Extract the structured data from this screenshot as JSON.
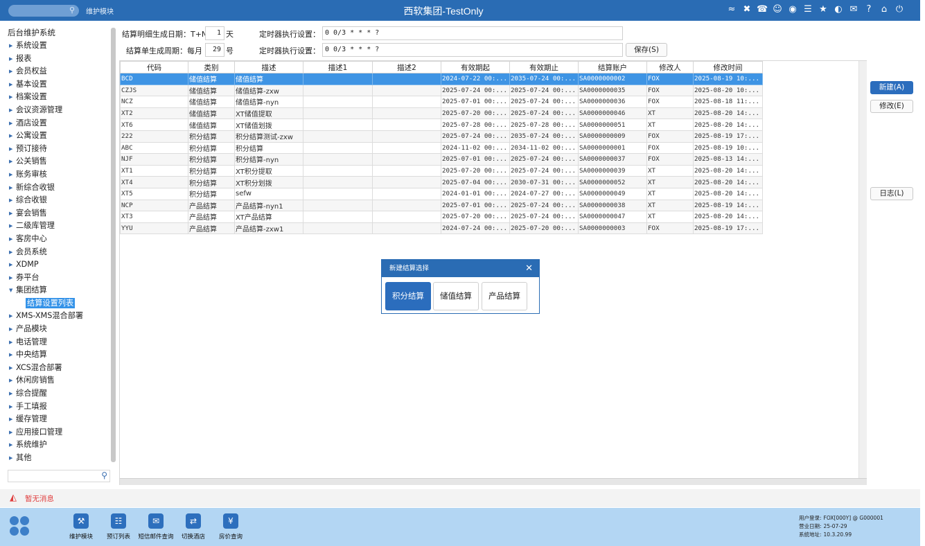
{
  "titlebar": {
    "search_placeholder": "",
    "module": "维护模块",
    "title": "西软集团-TestOnly",
    "icons": [
      "wifi-icon",
      "tools-icon",
      "phone-icon",
      "chat-icon",
      "palette-icon",
      "menu-icon",
      "star-icon",
      "contrast-icon",
      "mail-icon",
      "help-icon",
      "home-icon",
      "power-icon"
    ]
  },
  "sidebar": {
    "root": "后台维护系统",
    "items": [
      {
        "label": "系统设置"
      },
      {
        "label": "报表"
      },
      {
        "label": "会员权益"
      },
      {
        "label": "基本设置"
      },
      {
        "label": "档案设置"
      },
      {
        "label": "会议资源管理"
      },
      {
        "label": "酒店设置"
      },
      {
        "label": "公寓设置"
      },
      {
        "label": "预订接待"
      },
      {
        "label": "公关销售"
      },
      {
        "label": "账务审核"
      },
      {
        "label": "新综合收银"
      },
      {
        "label": "综合收银"
      },
      {
        "label": "宴会销售"
      },
      {
        "label": "二级库管理"
      },
      {
        "label": "客房中心"
      },
      {
        "label": "会员系统"
      },
      {
        "label": "XDMP"
      },
      {
        "label": "券平台"
      },
      {
        "label": "集团结算"
      }
    ],
    "active_sub": "结算设置列表",
    "items_after": [
      {
        "label": "XMS-XMS混合部署"
      },
      {
        "label": "产品模块"
      },
      {
        "label": "电话管理"
      },
      {
        "label": "中央结算"
      },
      {
        "label": "XCS混合部署"
      },
      {
        "label": "休闲房销售"
      },
      {
        "label": "综合提醒"
      },
      {
        "label": "手工填报"
      },
      {
        "label": "缓存管理"
      },
      {
        "label": "应用接口管理"
      },
      {
        "label": "系统维护"
      },
      {
        "label": "其他"
      }
    ],
    "search_value": ""
  },
  "form": {
    "detail_label": "结算明细生成日期：T+N",
    "detail_value": "1",
    "detail_unit": "天",
    "timer1_label": "定时器执行设置：",
    "timer1_value": "0 0/3 * * * ?",
    "bill_label": "结算单生成周期：每月",
    "bill_value": "29",
    "bill_unit": "号",
    "timer2_label": "定时器执行设置：",
    "timer2_value": "0 0/3 * * * ?",
    "save_label": "保存(S)"
  },
  "grid": {
    "columns": [
      "代码",
      "类别",
      "描述",
      "描述1",
      "描述2",
      "有效期起",
      "有效期止",
      "结算账户",
      "修改人",
      "修改时间"
    ],
    "rows": [
      [
        "BCD",
        "储值结算",
        "储值结算",
        "",
        "",
        "2024-07-22 00:...",
        "2035-07-24 00:...",
        "SA0000000002",
        "FOX",
        "2025-08-19 10:..."
      ],
      [
        "CZJS",
        "储值结算",
        "储值结算-zxw",
        "",
        "",
        "2025-07-24 00:...",
        "2025-07-24 00:...",
        "SA0000000035",
        "FOX",
        "2025-08-20 10:..."
      ],
      [
        "NCZ",
        "储值结算",
        "储值结算-nyn",
        "",
        "",
        "2025-07-01 00:...",
        "2025-07-24 00:...",
        "SA0000000036",
        "FOX",
        "2025-08-18 11:..."
      ],
      [
        "XT2",
        "储值结算",
        "XT储值提取",
        "",
        "",
        "2025-07-20 00:...",
        "2025-07-24 00:...",
        "SA0000000046",
        "XT",
        "2025-08-20 14:..."
      ],
      [
        "XT6",
        "储值结算",
        "XT储值划拨",
        "",
        "",
        "2025-07-28 00:...",
        "2025-07-28 00:...",
        "SA0000000051",
        "XT",
        "2025-08-20 14:..."
      ],
      [
        "222",
        "积分结算",
        "积分结算测试-zxw",
        "",
        "",
        "2025-07-24 00:...",
        "2035-07-24 00:...",
        "SA0000000009",
        "FOX",
        "2025-08-19 17:..."
      ],
      [
        "ABC",
        "积分结算",
        "积分结算",
        "",
        "",
        "2024-11-02 00:...",
        "2034-11-02 00:...",
        "SA0000000001",
        "FOX",
        "2025-08-19 10:..."
      ],
      [
        "NJF",
        "积分结算",
        "积分结算-nyn",
        "",
        "",
        "2025-07-01 00:...",
        "2025-07-24 00:...",
        "SA0000000037",
        "FOX",
        "2025-08-13 14:..."
      ],
      [
        "XT1",
        "积分结算",
        "XT积分提取",
        "",
        "",
        "2025-07-20 00:...",
        "2025-07-24 00:...",
        "SA0000000039",
        "XT",
        "2025-08-20 14:..."
      ],
      [
        "XT4",
        "积分结算",
        "XT积分划拨",
        "",
        "",
        "2025-07-04 00:...",
        "2030-07-31 00:...",
        "SA0000000052",
        "XT",
        "2025-08-20 14:..."
      ],
      [
        "XT5",
        "积分结算",
        "sefw",
        "",
        "",
        "2024-01-01 00:...",
        "2024-07-27 00:...",
        "SA0000000049",
        "XT",
        "2025-08-20 14:..."
      ],
      [
        "NCP",
        "产品结算",
        "产品结算-nyn1",
        "",
        "",
        "2025-07-01 00:...",
        "2025-07-24 00:...",
        "SA0000000038",
        "XT",
        "2025-08-19 14:..."
      ],
      [
        "XT3",
        "产品结算",
        "XT产品结算",
        "",
        "",
        "2025-07-20 00:...",
        "2025-07-24 00:...",
        "SA0000000047",
        "XT",
        "2025-08-20 14:..."
      ],
      [
        "YYU",
        "产品结算",
        "产品结算-zxw1",
        "",
        "",
        "2024-07-24 00:...",
        "2025-07-20 00:...",
        "SA0000000003",
        "FOX",
        "2025-08-19 17:..."
      ]
    ],
    "selected_row": 0
  },
  "actions": {
    "new_label": "新建(A)",
    "edit_label": "修改(E)",
    "log_label": "日志(L)"
  },
  "dialog": {
    "title": "新建结算选择",
    "close": "✕",
    "options": [
      "积分结算",
      "储值结算",
      "产品结算"
    ],
    "active_option": 0
  },
  "message": {
    "text": "暂无消息"
  },
  "dock": [
    {
      "label": "维护模块",
      "icon": "wrench-icon"
    },
    {
      "label": "预订列表",
      "icon": "document-icon"
    },
    {
      "label": "短信邮件查询",
      "icon": "mail-icon"
    },
    {
      "label": "切换酒店",
      "icon": "switch-icon"
    },
    {
      "label": "房价查询",
      "icon": "price-icon"
    }
  ],
  "status": {
    "user_label": "用户登录:",
    "user_value": "FOX[000Y] @ G000001",
    "date_label": "营业日期:",
    "date_value": "25-07-29",
    "addr_label": "系统地址:",
    "addr_value": "10.3.20.99"
  },
  "colors": {
    "brand": "#2a6cb4",
    "selection": "#3e94e4",
    "dock_bg": "#b3d6f3",
    "alert": "#e03e3e"
  }
}
